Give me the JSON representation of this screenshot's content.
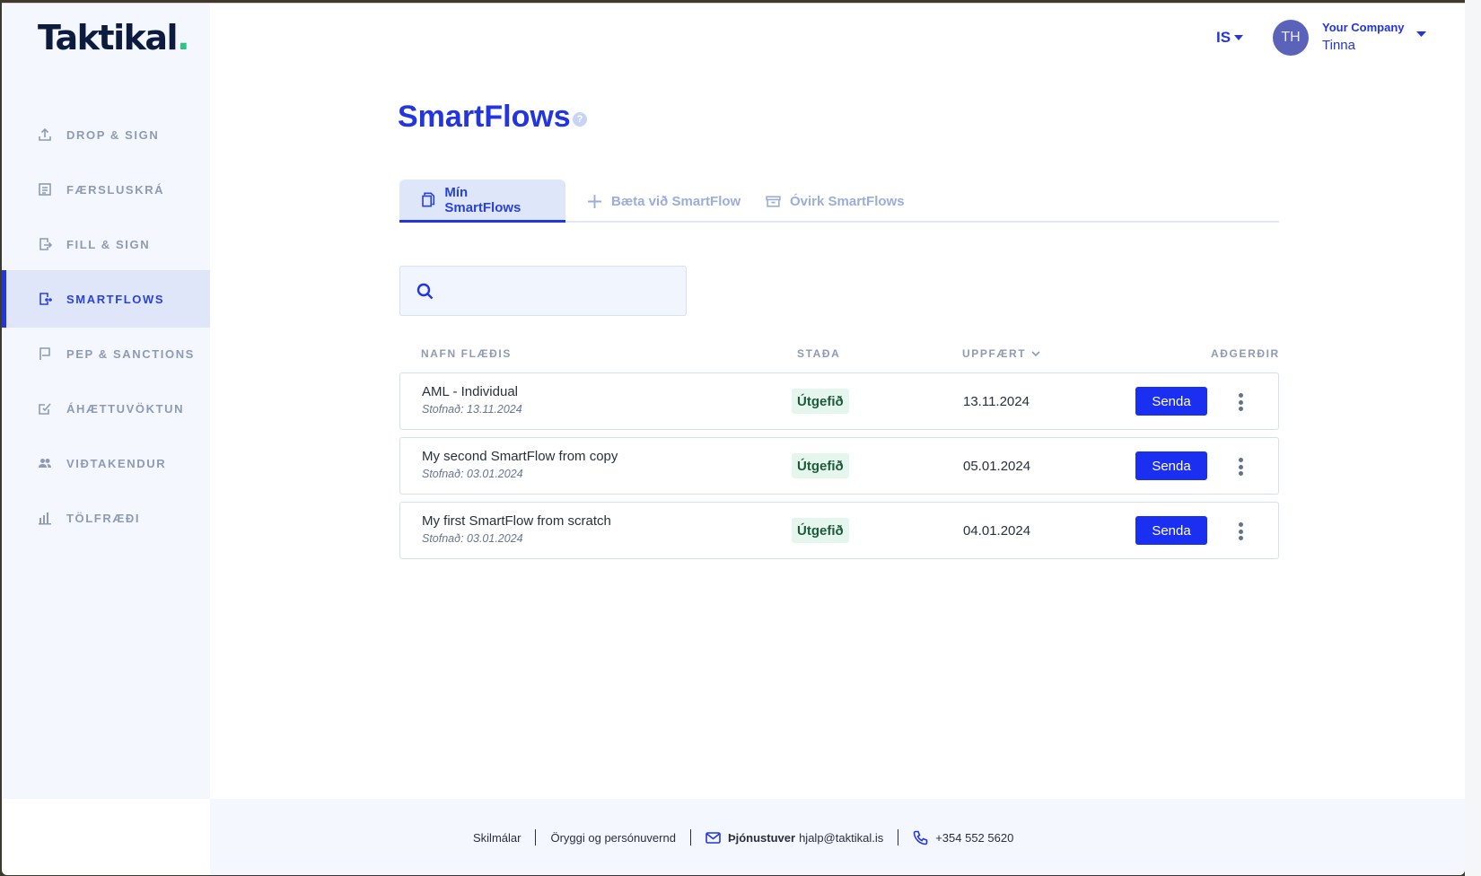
{
  "app": {
    "logo_text": "Taktikal",
    "logo_dot": "."
  },
  "sidebar": {
    "items": [
      {
        "label": "DROP & SIGN",
        "icon": "upload-icon"
      },
      {
        "label": "FÆRSLUSKRÁ",
        "icon": "log-icon"
      },
      {
        "label": "FILL & SIGN",
        "icon": "document-sign-icon"
      },
      {
        "label": "SMARTFLOWS",
        "icon": "smartflow-icon",
        "active": true
      },
      {
        "label": "PEP & SANCTIONS",
        "icon": "flag-icon"
      },
      {
        "label": "ÁHÆTTUVÖKTUN",
        "icon": "checklist-icon"
      },
      {
        "label": "VIÐTAKENDUR",
        "icon": "people-icon"
      },
      {
        "label": "TÖLFRÆÐI",
        "icon": "bar-chart-icon"
      }
    ]
  },
  "header": {
    "language": "IS",
    "avatar_initials": "TH",
    "company": "Your Company",
    "user": "Tinna"
  },
  "main": {
    "title": "SmartFlows",
    "help_symbol": "?",
    "tabs": [
      {
        "label": "Mín SmartFlows",
        "icon": "document-copy-icon",
        "active": true
      },
      {
        "label": "Bæta við SmartFlow",
        "icon": "plus-icon"
      },
      {
        "label": "Óvirk SmartFlows",
        "icon": "archive-icon"
      }
    ],
    "search": {
      "value": "",
      "placeholder": ""
    },
    "table": {
      "headers": {
        "name": "NAFN FLÆÐIS",
        "status": "STAÐA",
        "updated": "UPPFÆRT",
        "actions": "AÐGERÐIR"
      },
      "rows": [
        {
          "name": "AML - Individual",
          "created": "Stofnað: 13.11.2024",
          "status": "Útgefið",
          "updated": "13.11.2024",
          "action": "Senda"
        },
        {
          "name": "My second SmartFlow from copy",
          "created": "Stofnað: 03.01.2024",
          "status": "Útgefið",
          "updated": "05.01.2024",
          "action": "Senda"
        },
        {
          "name": "My first SmartFlow from scratch",
          "created": "Stofnað: 03.01.2024",
          "status": "Útgefið",
          "updated": "04.01.2024",
          "action": "Senda"
        }
      ]
    }
  },
  "footer": {
    "terms": "Skilmálar",
    "privacy": "Öryggi og persónuvernd",
    "support_label": "Þjónustuver",
    "support_email": "hjalp@taktikal.is",
    "phone": "+354 552 5620"
  },
  "colors": {
    "accent": "#2235e0",
    "button": "#1a2ff0",
    "sidebar_bg": "#f4f7fd",
    "status_bg": "#e4f6ee",
    "logo_dot": "#2ec486"
  }
}
